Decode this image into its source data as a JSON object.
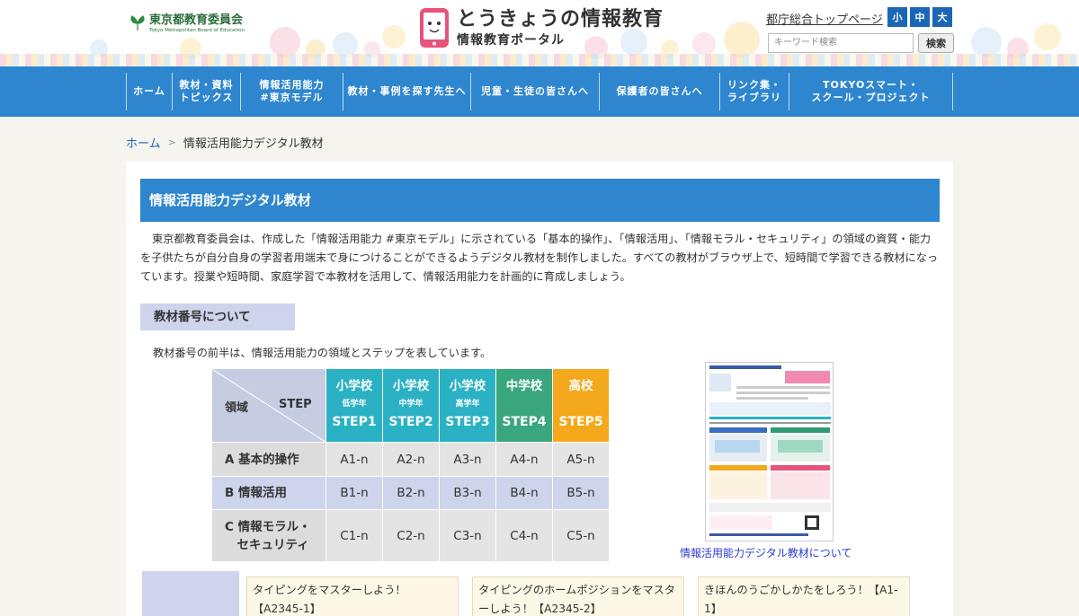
{
  "header": {
    "org_name_ja": "東京都教育委員会",
    "org_name_en": "Tokyo Metropolitan Board of Education",
    "site_title": "とうきょうの情報教育",
    "site_subtitle": "情報教育ポータル",
    "top_link": "都庁総合トップページ",
    "font_sizes": [
      "小",
      "中",
      "大"
    ],
    "search_placeholder": "キーワード検索",
    "search_button": "検索"
  },
  "nav": {
    "items": [
      "ホーム",
      "教材・資料\nトピックス",
      "情報活用能力\n#東京モデル",
      "教材・事例を探す先生へ",
      "児童・生徒の皆さんへ",
      "保護者の皆さんへ",
      "リンク集・\nライブラリ",
      "TOKYOスマート・\nスクール・プロジェクト"
    ]
  },
  "breadcrumb": {
    "home": "ホーム",
    "sep": ">",
    "current": "情報活用能力デジタル教材"
  },
  "main": {
    "title": "情報活用能力デジタル教材",
    "intro": "東京都教育委員会は、作成した「情報活用能力 #東京モデル」に示されている「基本的操作」、「情報活用」、「情報モラル・セキュリティ」の領域の資質・能力を子供たちが自分自身の学習者用端末で身につけることができるようデジタル教材を制作しました。すべての教材がブラウザ上で、短時間で学習できる教材になっています。授業や短時間、家庭学習で本教材を活用して、情報活用能力を計画的に育成しましょう。",
    "section_heading": "教材番号について",
    "section_note": "教材番号の前半は、情報活用能力の領域とステップを表しています。",
    "thumbnail_caption": "情報活用能力デジタル教材について"
  },
  "step_table": {
    "corner_left": "領域",
    "corner_right": "STEP",
    "columns": [
      {
        "level": "小学校",
        "grade": "低学年",
        "step": "STEP1",
        "color": "#2ab2c4"
      },
      {
        "level": "小学校",
        "grade": "中学年",
        "step": "STEP2",
        "color": "#2ab2c4"
      },
      {
        "level": "小学校",
        "grade": "高学年",
        "step": "STEP3",
        "color": "#2ab2c4"
      },
      {
        "level": "中学校",
        "grade": "",
        "step": "STEP4",
        "color": "#3aa67e"
      },
      {
        "level": "高校",
        "grade": "",
        "step": "STEP5",
        "color": "#f4a81c"
      }
    ],
    "rows": [
      {
        "label": "A 基本的操作",
        "cells": [
          "A1-n",
          "A2-n",
          "A3-n",
          "A4-n",
          "A5-n"
        ]
      },
      {
        "label": "B 情報活用",
        "cells": [
          "B1-n",
          "B2-n",
          "B3-n",
          "B4-n",
          "B5-n"
        ]
      },
      {
        "label": "C 情報モラル・\n　セキュリティ",
        "cells": [
          "C1-n",
          "C2-n",
          "C3-n",
          "C4-n",
          "C5-n"
        ]
      }
    ]
  },
  "lessons": [
    "タイピングをマスターしよう！【A2345-1】",
    "タイピングのホームポジションをマスターしよう！【A2345-2】",
    "きほんのうごかしかたをしろう！【A1-1】"
  ],
  "colors": {
    "nav_blue": "#2e86cf",
    "title_blue": "#2e86cf",
    "section_lavender": "#cdd4eb",
    "link_blue": "#1a67b5"
  }
}
